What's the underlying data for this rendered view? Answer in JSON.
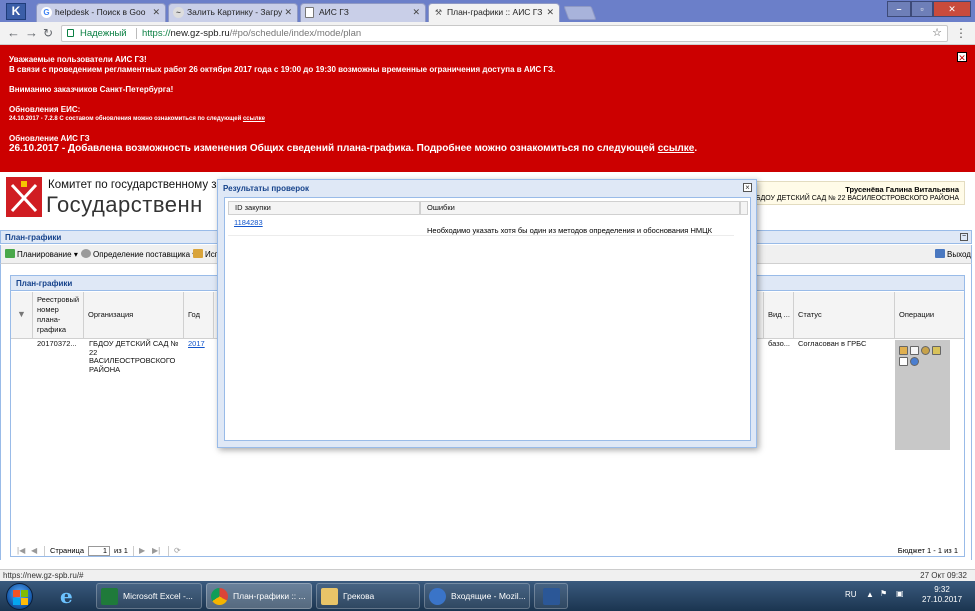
{
  "browser": {
    "k_logo": "K",
    "tabs": [
      {
        "title": "helpdesk - Поиск в Goo",
        "favicon": "G"
      },
      {
        "title": "Залить Картинку - Загру",
        "favicon": "~"
      },
      {
        "title": "АИС ГЗ",
        "favicon": ""
      },
      {
        "title": "План-графики :: АИС ГЗ",
        "favicon": ""
      }
    ],
    "secure_label": "Надежный",
    "url_scheme": "https://",
    "url_host": "new.gz-spb.ru",
    "url_path": "/#po/schedule/index/mode/plan"
  },
  "banner": {
    "line1": "Уважаемые пользователи АИС ГЗ!",
    "line2": "В связи с проведением регламентных работ 26 октября 2017 года с 19:00 до 19:30 возможны временные ограничения доступа в АИС ГЗ.",
    "line3": "Вниманию заказчиков Санкт-Петербурга!",
    "eis_title": "Обновления ЕИС:",
    "eis_text": "24.10.2017 - 7.2.8 С составом обновления можно ознакомиться по следующей",
    "eis_link": "ссылке",
    "ais_title": "Обновление АИС ГЗ",
    "ais_text": "26.10.2017 - Добавлена возможность изменения Общих сведений плана-графика. Подробнее можно ознакомиться по следующей",
    "ais_link": "ссылке",
    "ais_end": "."
  },
  "header": {
    "committee": "Комитет по государственному заказу С",
    "title": "Государственн",
    "user_name": "Трусенёва Галина Витальевна",
    "user_org": "ГБДОУ ДЕТСКИЙ САД № 22 ВАСИЛЕОСТРОВСКОГО РАЙОНА"
  },
  "panel": {
    "title": "План-графики",
    "collapse": "−"
  },
  "toolbar": {
    "planning": "Планирование ▾",
    "supplier": "Определение поставщика ▾",
    "execution": "Исп",
    "exit": "Выход"
  },
  "grid": {
    "title": "План-графики",
    "headers": {
      "reg": [
        "Реестровый",
        "номер",
        "плана-",
        "графика"
      ],
      "org": "Организация",
      "year": "Год",
      "kind": "Вид ...",
      "status": "Статус",
      "ops": "Операции"
    },
    "row": {
      "reg": "20170372...",
      "org": [
        "ГБДОУ ДЕТСКИЙ САД №",
        "22",
        "ВАСИЛЕОСТРОВСКОГО",
        "РАЙОНА"
      ],
      "year": "2017",
      "kind": "базо...",
      "status": "Согласован в ГРБС"
    },
    "pager": {
      "first": "|◀",
      "prev": "◀",
      "page_label": "Страница",
      "page": "1",
      "of": "из 1",
      "next": "▶",
      "last": "▶|",
      "refresh": "⟳",
      "summary": "Бюджет 1 - 1 из 1"
    }
  },
  "modal": {
    "title": "Результаты проверок",
    "close": "×",
    "col_id": "ID закупки",
    "col_errors": "Ошибки",
    "rows": [
      {
        "id": "1184283",
        "error": "Необходимо указать хотя бы один из методов определения и обоснования НМЦК"
      }
    ]
  },
  "statusbar": {
    "url": "https://new.gz-spb.ru/#",
    "datetime": "27 Окт 09:32"
  },
  "taskbar": {
    "apps": [
      {
        "label": "Microsoft Excel -..."
      },
      {
        "label": "План-графики :: ..."
      },
      {
        "label": "Грекова"
      },
      {
        "label": "Входящие - Mozil..."
      },
      {
        "label": ""
      }
    ],
    "lang": "RU",
    "time": "9:32",
    "date": "27.10.2017"
  },
  "colors": {
    "banner_bg": "#cc0000",
    "panel_header": "#dfe8f6",
    "panel_border": "#99bbe8",
    "link": "#1155cc"
  }
}
